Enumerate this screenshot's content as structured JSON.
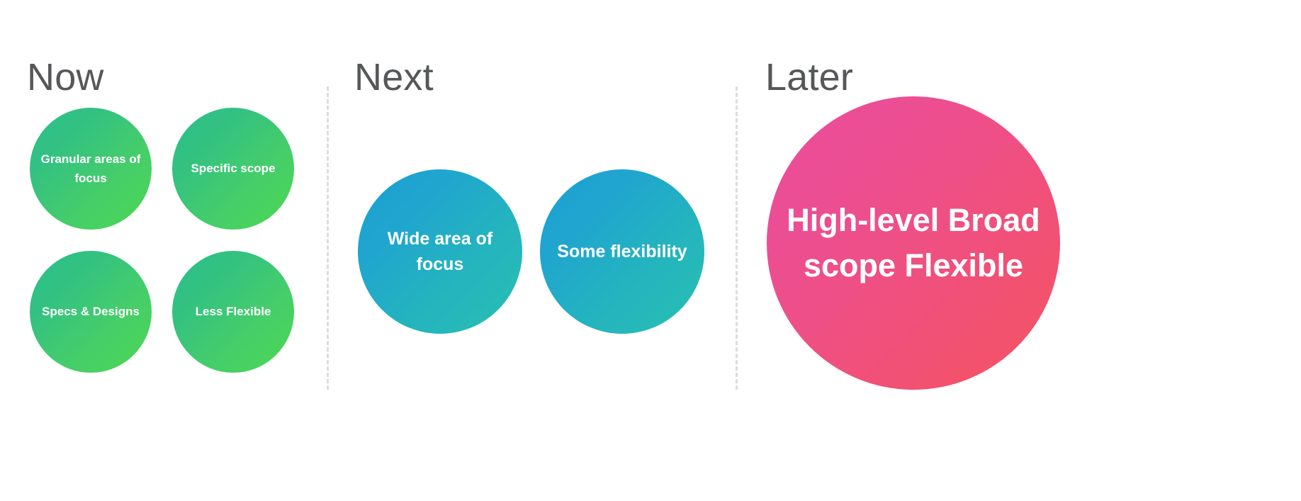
{
  "background_color": "#ffffff",
  "columns": [
    {
      "id": "now",
      "header": "Now",
      "header_color": "#555759",
      "bubble_gradient_from": "#2bc08b",
      "bubble_gradient_to": "#4cd851",
      "bubbles": [
        {
          "label": "Granular areas of focus"
        },
        {
          "label": "Specific scope"
        },
        {
          "label": "Specs & Designs"
        },
        {
          "label": "Less Flexible"
        }
      ]
    },
    {
      "id": "next",
      "header": "Next",
      "header_color": "#555759",
      "bubble_gradient_from": "#1c9fd4",
      "bubble_gradient_to": "#28bfb2",
      "bubbles": [
        {
          "label": "Wide area of focus"
        },
        {
          "label": "Some flexibility"
        }
      ]
    },
    {
      "id": "later",
      "header": "Later",
      "header_color": "#555759",
      "bubble_gradient_from": "#ea4d9c",
      "bubble_gradient_to": "#f4535f",
      "bubbles": [
        {
          "label": "High-level Broad scope Flexible"
        }
      ]
    }
  ],
  "dividers": {
    "style": "dashed",
    "color": "#dcdddf"
  }
}
